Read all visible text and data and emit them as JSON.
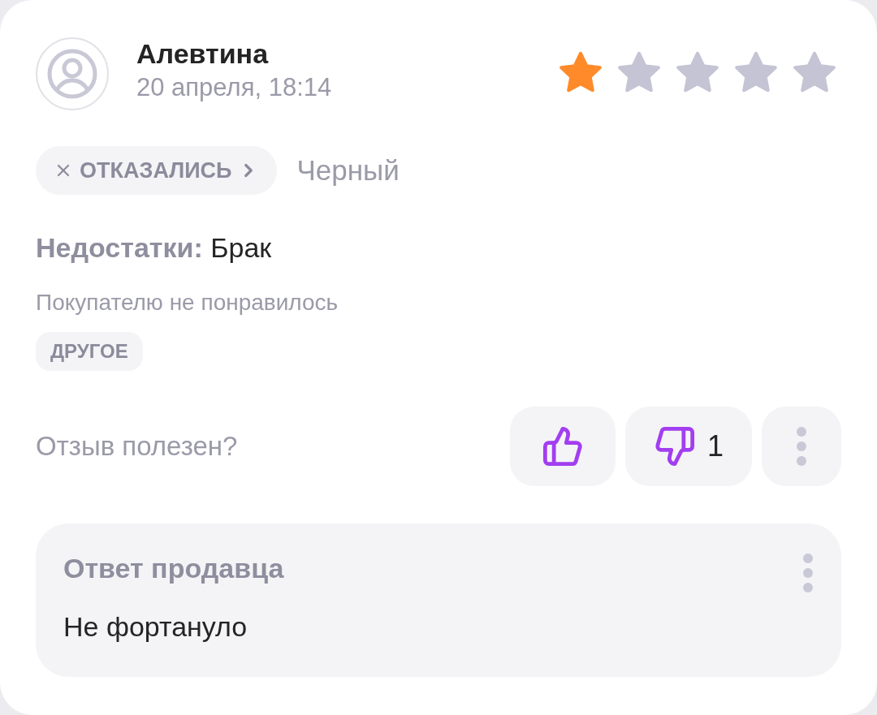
{
  "review": {
    "author": "Алевтина",
    "date": "20 апреля, 18:14",
    "stars": 1,
    "status": {
      "label": "ОТКАЗАЛИСЬ"
    },
    "variant": "Черный",
    "defects": {
      "label": "Недостатки:",
      "value": "Брак"
    },
    "reason": "Покупателю не понравилось",
    "tags": [
      "ДРУГОЕ"
    ]
  },
  "helpful": {
    "question": "Отзыв полезен?",
    "dislike_count": "1"
  },
  "seller_reply": {
    "title": "Ответ продавца",
    "text": "Не фортануло"
  }
}
